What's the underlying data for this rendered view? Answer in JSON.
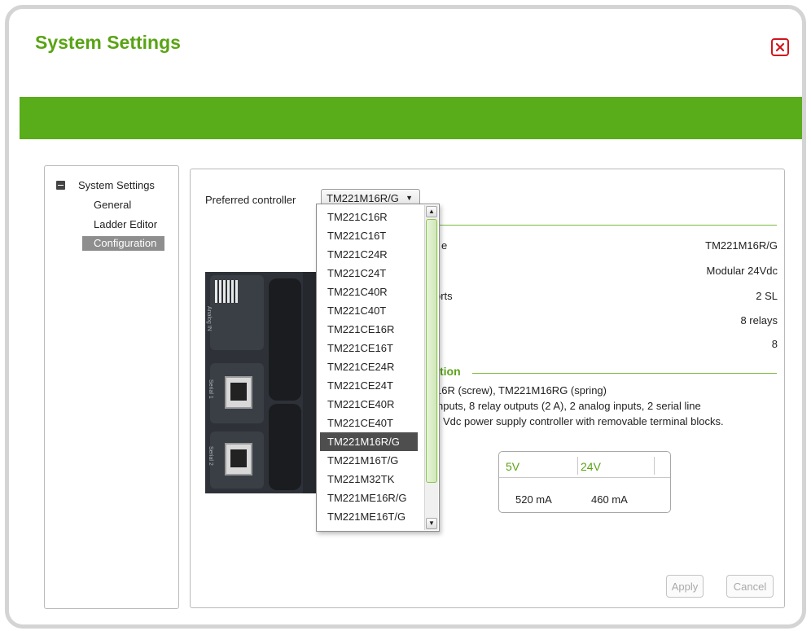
{
  "dialog": {
    "title": "System Settings",
    "close_icon": "close-icon"
  },
  "tree": {
    "root": "System Settings",
    "items": [
      "General",
      "Ladder Editor",
      "Configuration"
    ],
    "selected": "Configuration"
  },
  "config": {
    "preferred_label": "Preferred controller",
    "selected_controller": "TM221M16R/G",
    "properties": [
      {
        "label": "e",
        "value": "TM221M16R/G"
      },
      {
        "label": "",
        "value": "Modular 24Vdc"
      },
      {
        "label": "orts",
        "value": "2 SL"
      },
      {
        "label": "",
        "value": "8 relays"
      },
      {
        "label": "",
        "value": "8"
      }
    ],
    "description_title": "tion",
    "description_lines": [
      "16R (screw), TM221M16RG (spring)",
      "nputs, 8 relay outputs (2 A), 2 analog inputs, 2 serial line",
      "Vdc power supply controller with removable terminal blocks."
    ],
    "power": {
      "headers": [
        "5V",
        "24V"
      ],
      "values": [
        "520 mA",
        "460 mA"
      ]
    },
    "apply_label": "Apply",
    "cancel_label": "Cancel"
  },
  "dropdown": {
    "items": [
      "TM221C16R",
      "TM221C16T",
      "TM221C24R",
      "TM221C24T",
      "TM221C40R",
      "TM221C40T",
      "TM221CE16R",
      "TM221CE16T",
      "TM221CE24R",
      "TM221CE24T",
      "TM221CE40R",
      "TM221CE40T",
      "TM221M16R/G",
      "TM221M16T/G",
      "TM221M32TK",
      "TM221ME16R/G",
      "TM221ME16T/G"
    ],
    "selected_index": 12
  },
  "controller_labels": {
    "port1": "Serial 1",
    "port2": "Serial 2",
    "side": "Analog IN"
  },
  "colors": {
    "brand_green": "#59ac1a",
    "title_green": "#5aa315",
    "close_red": "#d2141c"
  }
}
